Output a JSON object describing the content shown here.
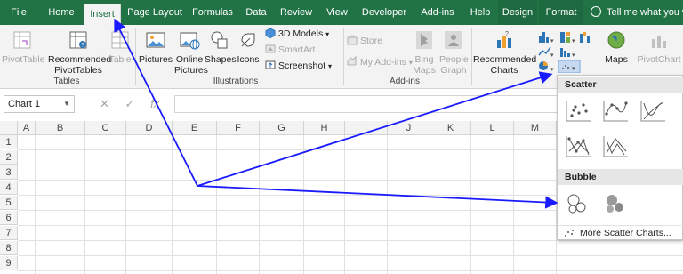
{
  "tabs": [
    {
      "label": "File"
    },
    {
      "label": "Home"
    },
    {
      "label": "Insert"
    },
    {
      "label": "Page Layout"
    },
    {
      "label": "Formulas"
    },
    {
      "label": "Data"
    },
    {
      "label": "Review"
    },
    {
      "label": "View"
    },
    {
      "label": "Developer"
    },
    {
      "label": "Add-ins"
    },
    {
      "label": "Help"
    },
    {
      "label": "Design"
    },
    {
      "label": "Format"
    }
  ],
  "tell_me": "Tell me what you wa",
  "ribbon": {
    "tables": {
      "pivottable": "PivotTable",
      "recommended_pivot": "Recommended PivotTables",
      "table": "Table",
      "group": "Tables"
    },
    "illustrations": {
      "pictures": "Pictures",
      "online_pictures": "Online Pictures",
      "shapes": "Shapes",
      "icons": "Icons",
      "models": "3D Models",
      "smartart": "SmartArt",
      "screenshot": "Screenshot",
      "group": "Illustrations"
    },
    "addins": {
      "store": "Store",
      "my_addins": "My Add-ins",
      "bing_maps": "Bing Maps",
      "people_graph": "People Graph",
      "group": "Add-ins"
    },
    "charts": {
      "recommended": "Recommended Charts",
      "maps": "Maps",
      "pivotchart": "PivotChart"
    }
  },
  "formula_bar": {
    "name_box": "Chart 1",
    "fx": "fx"
  },
  "columns": [
    "A",
    "B",
    "C",
    "D",
    "E",
    "F",
    "G",
    "H",
    "I",
    "J",
    "K",
    "L",
    "M"
  ],
  "rows": [
    "1",
    "2",
    "3",
    "4",
    "5",
    "6",
    "7",
    "8",
    "9"
  ],
  "dropdown": {
    "scatter_header": "Scatter",
    "bubble_header": "Bubble",
    "more": "More Scatter Charts..."
  },
  "colors": {
    "excel_green": "#217346",
    "ribbon_bg": "#f3f3f3",
    "arrow": "#1a1aff"
  }
}
